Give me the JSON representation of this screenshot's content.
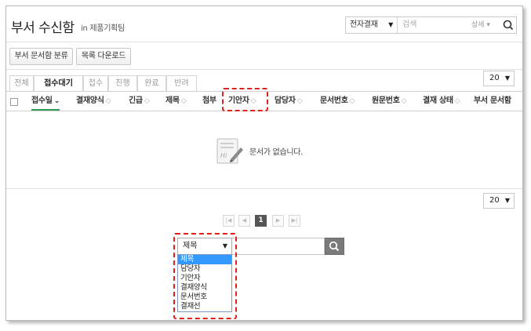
{
  "header": {
    "title": "부서 수신함",
    "subtitle": "in 제품기획팀"
  },
  "top_search": {
    "type_value": "전자결재",
    "placeholder": "검색",
    "detail_label": "상세 ▾"
  },
  "toolbar": {
    "classify_label": "부서 문서함 분류",
    "download_label": "목록 다운로드"
  },
  "tabs": [
    {
      "label": "전체",
      "active": false
    },
    {
      "label": "접수대기",
      "active": true
    },
    {
      "label": "접수",
      "active": false
    },
    {
      "label": "진행",
      "active": false
    },
    {
      "label": "완료",
      "active": false
    },
    {
      "label": "반려",
      "active": false
    }
  ],
  "page_size": "20",
  "columns": [
    {
      "label": "접수일",
      "sort": "⌄",
      "sorted": true
    },
    {
      "label": "결재양식",
      "sort": "◇",
      "sorted": false
    },
    {
      "label": "긴급",
      "sort": "◇",
      "sorted": false
    },
    {
      "label": "제목",
      "sort": "◇",
      "sorted": false
    },
    {
      "label": "첨부",
      "sort": "",
      "sorted": false
    },
    {
      "label": "기안자",
      "sort": "◇",
      "sorted": false
    },
    {
      "label": "담당자",
      "sort": "◇",
      "sorted": false
    },
    {
      "label": "문서번호",
      "sort": "◇",
      "sorted": false
    },
    {
      "label": "원문번호",
      "sort": "◇",
      "sorted": false
    },
    {
      "label": "결재 상태",
      "sort": "◇",
      "sorted": false
    },
    {
      "label": "부서 문서함",
      "sort": "",
      "sorted": false
    }
  ],
  "empty_message": "문서가 없습니다.",
  "pagination": {
    "current_page": "1"
  },
  "bottom_search": {
    "selected": "제목",
    "options": [
      "제목",
      "담당자",
      "기안자",
      "결재양식",
      "문서번호",
      "결재선"
    ]
  },
  "colors": {
    "accent_green": "#2e9c53",
    "highlight_red": "#e0201a",
    "dropdown_selected": "#3399ff"
  }
}
